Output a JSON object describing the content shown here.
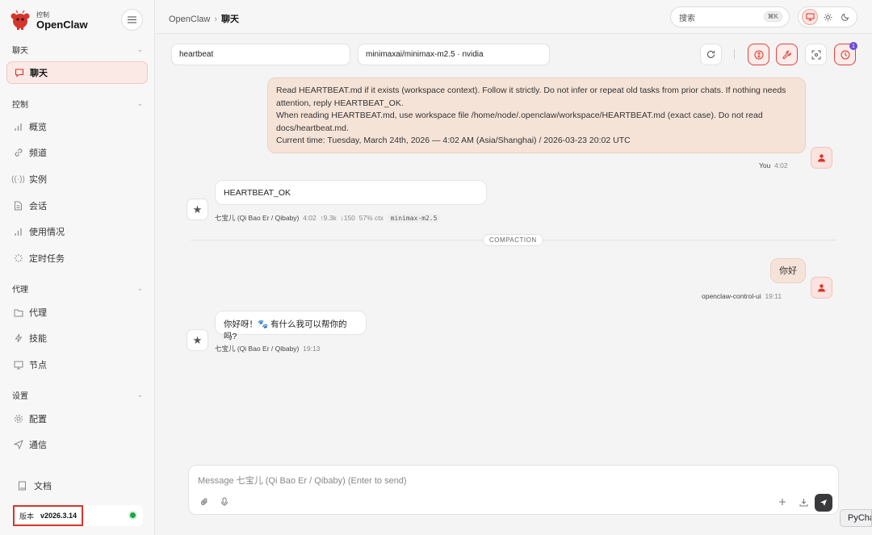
{
  "brand": {
    "sub": "控制",
    "name": "OpenClaw",
    "accent": "#d7342b"
  },
  "sidebar": {
    "sections": [
      {
        "title": "聊天",
        "items": [
          {
            "label": "聊天",
            "icon": "chat-icon",
            "active": true
          }
        ]
      },
      {
        "title": "控制",
        "items": [
          {
            "label": "概览",
            "icon": "bar-chart-icon"
          },
          {
            "label": "频道",
            "icon": "link-icon"
          },
          {
            "label": "实例",
            "icon": "broadcast-icon"
          },
          {
            "label": "会话",
            "icon": "document-icon"
          },
          {
            "label": "使用情况",
            "icon": "bar-chart-icon"
          },
          {
            "label": "定时任务",
            "icon": "loader-icon"
          }
        ]
      },
      {
        "title": "代理",
        "items": [
          {
            "label": "代理",
            "icon": "folder-icon"
          },
          {
            "label": "技能",
            "icon": "lightning-icon"
          },
          {
            "label": "节点",
            "icon": "monitor-icon"
          }
        ]
      },
      {
        "title": "设置",
        "items": [
          {
            "label": "配置",
            "icon": "gear-icon"
          },
          {
            "label": "通信",
            "icon": "send-icon"
          }
        ]
      }
    ],
    "docs": "文档",
    "version_label": "版本",
    "version": "v2026.3.14",
    "status_color": "#1fa34a"
  },
  "topbar": {
    "crumb_root": "OpenClaw",
    "crumb_sep": "›",
    "crumb_current": "聊天",
    "search_placeholder": "搜索",
    "search_kbd": "⌘K"
  },
  "chat": {
    "session": "heartbeat",
    "model": "minimaxai/minimax-m2.5 · nvidia",
    "badge_count": "1",
    "messages": [
      {
        "role": "user",
        "lines": [
          "Read HEARTBEAT.md if it exists (workspace context). Follow it strictly. Do not infer or repeat old tasks from prior chats. If nothing needs",
          "attention, reply HEARTBEAT_OK.",
          "When reading HEARTBEAT.md, use workspace file /home/node/.openclaw/workspace/HEARTBEAT.md (exact case). Do not read",
          "docs/heartbeat.md.",
          "Current time: Tuesday, March 24th, 2026 — 4:02 AM (Asia/Shanghai) / 2026-03-23 20:02 UTC"
        ],
        "sender": "You",
        "time": "4:02"
      },
      {
        "role": "assistant",
        "text": "HEARTBEAT_OK",
        "sender": "七宝儿 (Qi Bao Er / Qibaby)",
        "time": "4:02",
        "tokens_up": "↑9.3k",
        "tokens_down": "↓150",
        "ctx": "57% ctx",
        "model_tag": "minimax-m2.5"
      },
      {
        "role": "divider",
        "label": "COMPACTION"
      },
      {
        "role": "user",
        "text": "你好",
        "sender": "openclaw-control-ui",
        "time": "19:11"
      },
      {
        "role": "assistant",
        "text": "你好呀！🐾 有什么我可以帮你的吗?",
        "sender": "七宝儿 (Qi Bao Er / Qibaby)",
        "time": "19:13"
      }
    ],
    "composer_placeholder": "Message 七宝儿 (Qi Bao Er / Qibaby) (Enter to send)"
  },
  "taskbar": {
    "label": "PyCha"
  }
}
